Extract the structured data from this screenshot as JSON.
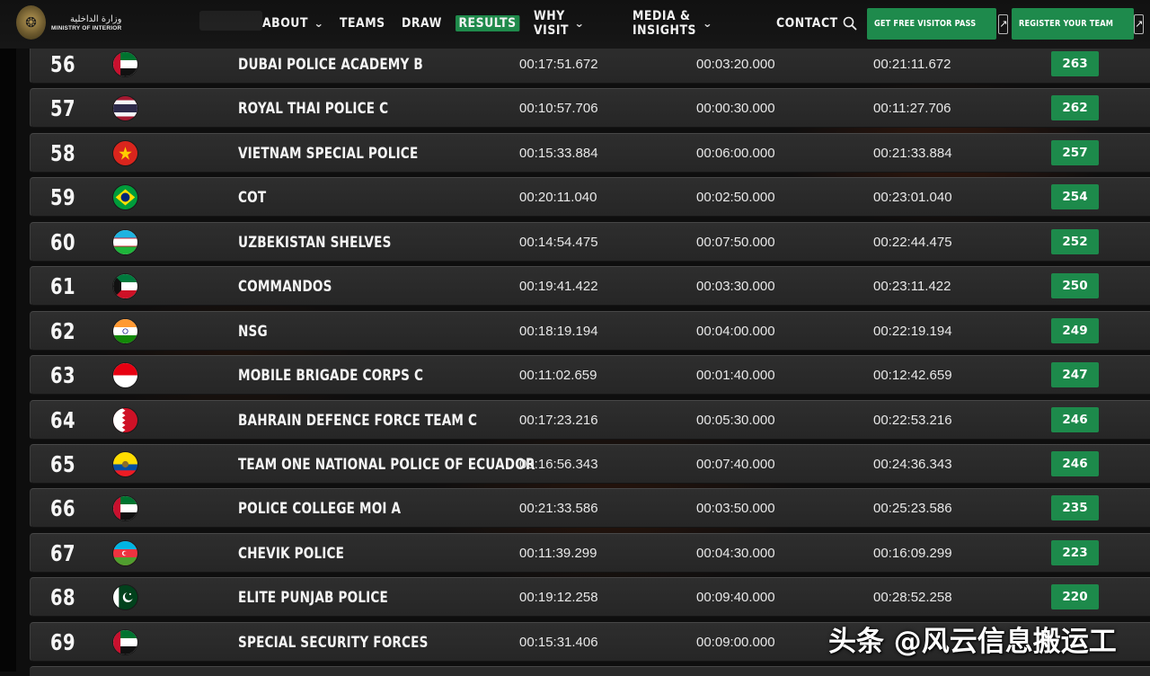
{
  "header": {
    "logo": {
      "arabic": "وزارة الداخلية",
      "english": "MINISTRY OF INTERIOR",
      "icon": "falcon-emblem-icon"
    },
    "nav": [
      {
        "label": "ABOUT",
        "dropdown": true,
        "active": false
      },
      {
        "label": "TEAMS",
        "dropdown": false,
        "active": false
      },
      {
        "label": "DRAW",
        "dropdown": false,
        "active": false
      },
      {
        "label": "RESULTS",
        "dropdown": false,
        "active": true
      },
      {
        "label": "WHY VISIT",
        "dropdown": true,
        "active": false
      },
      {
        "label": "MEDIA & INSIGHTS",
        "dropdown": true,
        "active": false
      },
      {
        "label": "CONTACT",
        "dropdown": false,
        "active": false
      }
    ],
    "search_icon": "search-icon",
    "visitor_pass_label": "GET FREE VISITOR PASS",
    "register_label": "REGISTER YOUR TEAM",
    "arrow_icon": "arrow-up-right-icon",
    "accent_color": "#1e8a4c"
  },
  "results": [
    {
      "rank": "56",
      "flag": "uae",
      "team": "DUBAI POLICE ACADEMY B",
      "time1": "00:17:51.672",
      "time2": "00:03:20.000",
      "total": "00:21:11.672",
      "score": "263"
    },
    {
      "rank": "57",
      "flag": "thailand",
      "team": "ROYAL THAI POLICE C",
      "time1": "00:10:57.706",
      "time2": "00:00:30.000",
      "total": "00:11:27.706",
      "score": "262"
    },
    {
      "rank": "58",
      "flag": "vietnam",
      "team": "VIETNAM SPECIAL POLICE",
      "time1": "00:15:33.884",
      "time2": "00:06:00.000",
      "total": "00:21:33.884",
      "score": "257"
    },
    {
      "rank": "59",
      "flag": "brazil",
      "team": "COT",
      "time1": "00:20:11.040",
      "time2": "00:02:50.000",
      "total": "00:23:01.040",
      "score": "254"
    },
    {
      "rank": "60",
      "flag": "uzbekistan",
      "team": "UZBEKISTAN SHELVES",
      "time1": "00:14:54.475",
      "time2": "00:07:50.000",
      "total": "00:22:44.475",
      "score": "252"
    },
    {
      "rank": "61",
      "flag": "kuwait",
      "team": "COMMANDOS",
      "time1": "00:19:41.422",
      "time2": "00:03:30.000",
      "total": "00:23:11.422",
      "score": "250"
    },
    {
      "rank": "62",
      "flag": "india",
      "team": "NSG",
      "time1": "00:18:19.194",
      "time2": "00:04:00.000",
      "total": "00:22:19.194",
      "score": "249"
    },
    {
      "rank": "63",
      "flag": "indonesia",
      "team": "MOBILE BRIGADE CORPS C",
      "time1": "00:11:02.659",
      "time2": "00:01:40.000",
      "total": "00:12:42.659",
      "score": "247"
    },
    {
      "rank": "64",
      "flag": "bahrain",
      "team": "BAHRAIN DEFENCE FORCE TEAM C",
      "time1": "00:17:23.216",
      "time2": "00:05:30.000",
      "total": "00:22:53.216",
      "score": "246"
    },
    {
      "rank": "65",
      "flag": "ecuador",
      "team": "TEAM ONE NATIONAL POLICE OF ECUADOR",
      "time1": "00:16:56.343",
      "time2": "00:07:40.000",
      "total": "00:24:36.343",
      "score": "246"
    },
    {
      "rank": "66",
      "flag": "uae",
      "team": "POLICE COLLEGE MOI A",
      "time1": "00:21:33.586",
      "time2": "00:03:50.000",
      "total": "00:25:23.586",
      "score": "235"
    },
    {
      "rank": "67",
      "flag": "azerbaijan",
      "team": "CHEVIK POLICE",
      "time1": "00:11:39.299",
      "time2": "00:04:30.000",
      "total": "00:16:09.299",
      "score": "223"
    },
    {
      "rank": "68",
      "flag": "pakistan",
      "team": "ELITE PUNJAB POLICE",
      "time1": "00:19:12.258",
      "time2": "00:09:40.000",
      "total": "00:28:52.258",
      "score": "220"
    },
    {
      "rank": "69",
      "flag": "uae",
      "team": "SPECIAL SECURITY FORCES",
      "time1": "00:15:31.406",
      "time2": "00:09:00.000",
      "total": "",
      "score": ""
    }
  ],
  "watermark": "头条 @风云信息搬运工"
}
